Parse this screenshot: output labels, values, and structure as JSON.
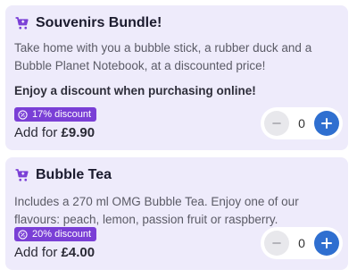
{
  "products": [
    {
      "title": "Souvenirs Bundle!",
      "description": "Take home with you a bubble stick, a rubber duck and a Bubble Planet Notebook, at a discounted price!",
      "note": "Enjoy a discount when purchasing online!",
      "discount": "17% discount",
      "price_prefix": "Add for",
      "price": "£9.90",
      "quantity": "0"
    },
    {
      "title": "Bubble Tea",
      "description": "Includes a 270 ml OMG Bubble Tea. Enjoy one of our flavours: peach, lemon, passion fruit or raspberry.",
      "discount": "20% discount",
      "price_prefix": "Add for",
      "price": "£4.00",
      "quantity": "0"
    }
  ],
  "icons": {
    "title_icon": "cart-plus-icon",
    "badge_icon": "percent-icon",
    "decrease": "minus-icon",
    "increase": "plus-icon"
  },
  "colors": {
    "card_bg": "#eeebfb",
    "accent_purple": "#7a3fd6",
    "accent_blue": "#2f6fd0"
  }
}
